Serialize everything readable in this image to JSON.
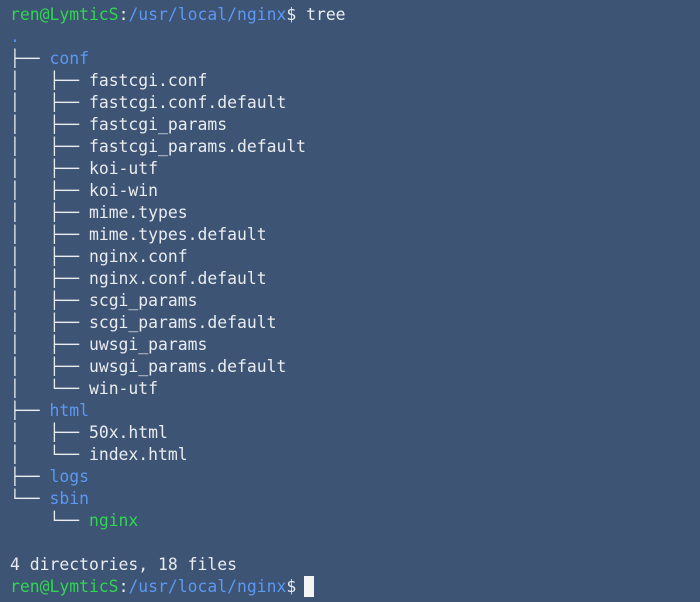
{
  "prompt": {
    "user": "ren@LymticS",
    "colon": ":",
    "path": "/usr/local/nginx",
    "dollar": "$"
  },
  "command": "tree",
  "root": ".",
  "tree": {
    "conf": {
      "connector": "├── ",
      "name": "conf",
      "files": [
        {
          "prefix": "│   ├── ",
          "name": "fastcgi.conf"
        },
        {
          "prefix": "│   ├── ",
          "name": "fastcgi.conf.default"
        },
        {
          "prefix": "│   ├── ",
          "name": "fastcgi_params"
        },
        {
          "prefix": "│   ├── ",
          "name": "fastcgi_params.default"
        },
        {
          "prefix": "│   ├── ",
          "name": "koi-utf"
        },
        {
          "prefix": "│   ├── ",
          "name": "koi-win"
        },
        {
          "prefix": "│   ├── ",
          "name": "mime.types"
        },
        {
          "prefix": "│   ├── ",
          "name": "mime.types.default"
        },
        {
          "prefix": "│   ├── ",
          "name": "nginx.conf"
        },
        {
          "prefix": "│   ├── ",
          "name": "nginx.conf.default"
        },
        {
          "prefix": "│   ├── ",
          "name": "scgi_params"
        },
        {
          "prefix": "│   ├── ",
          "name": "scgi_params.default"
        },
        {
          "prefix": "│   ├── ",
          "name": "uwsgi_params"
        },
        {
          "prefix": "│   ├── ",
          "name": "uwsgi_params.default"
        },
        {
          "prefix": "│   └── ",
          "name": "win-utf"
        }
      ]
    },
    "html": {
      "connector": "├── ",
      "name": "html",
      "files": [
        {
          "prefix": "│   ├── ",
          "name": "50x.html"
        },
        {
          "prefix": "│   └── ",
          "name": "index.html"
        }
      ]
    },
    "logs": {
      "connector": "├── ",
      "name": "logs"
    },
    "sbin": {
      "connector": "└── ",
      "name": "sbin",
      "files": [
        {
          "prefix": "    └── ",
          "name": "nginx"
        }
      ]
    }
  },
  "summary": "4 directories, 18 files",
  "colors": {
    "background": "#3e5474",
    "prompt_user": "#2fd651",
    "prompt_path": "#5c98f2",
    "directory": "#5c98f2",
    "executable": "#2fd651",
    "text": "#e8ecf0"
  }
}
